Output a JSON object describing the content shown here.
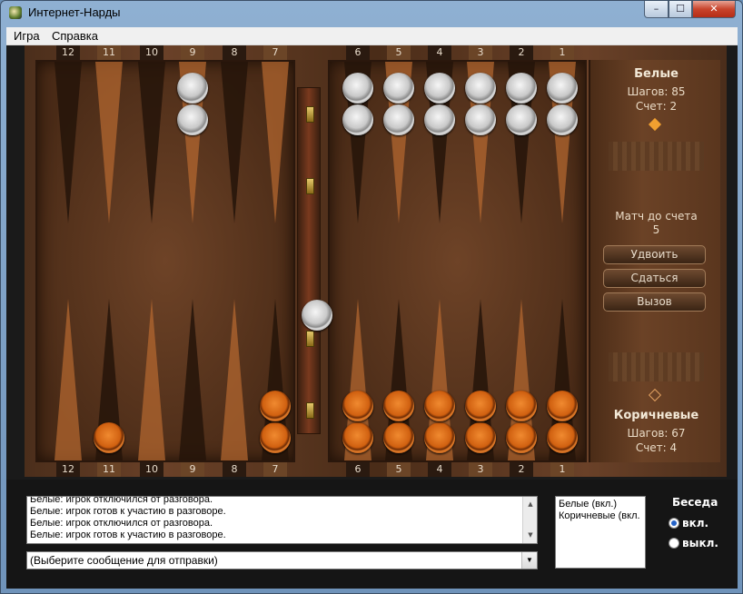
{
  "window": {
    "title": "Интернет-Нарды",
    "min": "–",
    "max": "☐",
    "close": "✕"
  },
  "menu": [
    {
      "label": "Игра"
    },
    {
      "label": "Справка"
    }
  ],
  "points_top": [
    "12",
    "11",
    "10",
    "9",
    "8",
    "7",
    "6",
    "5",
    "4",
    "3",
    "2",
    "1"
  ],
  "points_bottom": [
    "12",
    "11",
    "10",
    "9",
    "8",
    "7",
    "6",
    "5",
    "4",
    "3",
    "2",
    "1"
  ],
  "white_player": {
    "name": "Белые",
    "moves": "Шагов: 85",
    "score": "Счет: 2"
  },
  "brown_player": {
    "name": "Коричневые",
    "moves": "Шагов: 67",
    "score": "Счет: 4"
  },
  "match": {
    "label": "Матч до счета",
    "value": "5"
  },
  "buttons": {
    "double": "Удвоить",
    "resign": "Сдаться",
    "challenge": "Вызов"
  },
  "checkers": {
    "white_top": [
      {
        "point": "9",
        "count": 2
      },
      {
        "point": "6",
        "count": 2
      },
      {
        "point": "5",
        "count": 2
      },
      {
        "point": "4",
        "count": 2
      },
      {
        "point": "3",
        "count": 2
      },
      {
        "point": "2",
        "count": 2
      },
      {
        "point": "1",
        "count": 2
      }
    ],
    "white_bar": 1,
    "brown_bottom": [
      {
        "point": "11",
        "count": 1
      },
      {
        "point": "7",
        "count": 2
      },
      {
        "point": "6",
        "count": 2
      },
      {
        "point": "5",
        "count": 2
      },
      {
        "point": "4",
        "count": 2
      },
      {
        "point": "3",
        "count": 2
      },
      {
        "point": "2",
        "count": 2
      },
      {
        "point": "1",
        "count": 2
      }
    ]
  },
  "chat": {
    "lines": [
      "Белые: игрок отключился от разговора.",
      "Белые: игрок готов к участию в разговоре.",
      "Белые: игрок отключился от разговора.",
      "Белые: игрок готов к участию в разговоре."
    ],
    "message_select": "(Выберите сообщение для отправки)",
    "players": [
      "Белые (вкл.)",
      "Коричневые (вкл."
    ],
    "section_title": "Беседа",
    "on_label": "вкл.",
    "off_label": "выкл.",
    "selected": "вкл."
  },
  "colors": {
    "white_checker": "#d8d8d8",
    "brown_checker": "#d8651a",
    "board_wood": "#5a3520"
  }
}
